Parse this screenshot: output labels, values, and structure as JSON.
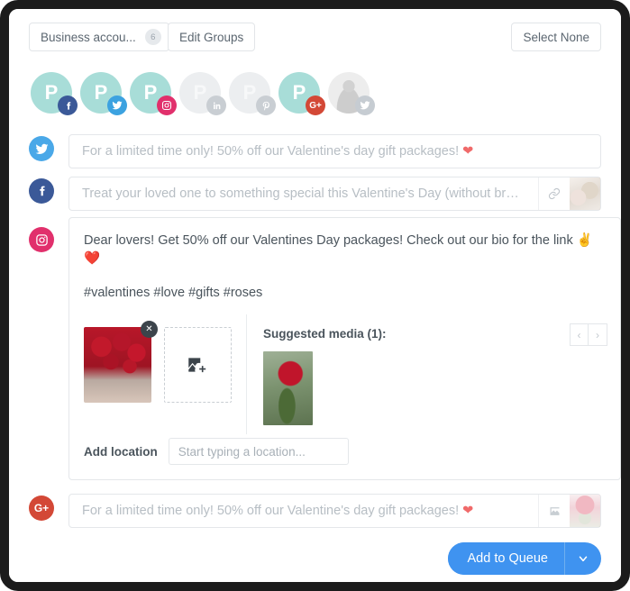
{
  "toolbar": {
    "group_select_label": "Business accou...",
    "group_select_count": "6",
    "edit_groups_label": "Edit Groups",
    "select_none_label": "Select None"
  },
  "accounts": [
    {
      "name": "profile-facebook",
      "letter": "P",
      "network": "facebook",
      "badge_label": "f",
      "active": true,
      "photo": false
    },
    {
      "name": "profile-twitter",
      "letter": "P",
      "network": "twitter",
      "badge_label": "t",
      "active": true,
      "photo": false
    },
    {
      "name": "profile-instagram",
      "letter": "P",
      "network": "instagram",
      "badge_label": "ig",
      "active": true,
      "photo": false
    },
    {
      "name": "profile-linkedin",
      "letter": "P",
      "network": "linkedin",
      "badge_label": "in",
      "active": false,
      "photo": false
    },
    {
      "name": "profile-pinterest",
      "letter": "P",
      "network": "pinterest",
      "badge_label": "p",
      "active": false,
      "photo": false
    },
    {
      "name": "profile-googleplus",
      "letter": "P",
      "network": "googleplus",
      "badge_label": "G+",
      "active": true,
      "photo": false
    },
    {
      "name": "profile-photo-twitter",
      "letter": "",
      "network": "twitter-muted",
      "badge_label": "t",
      "active": false,
      "photo": true
    }
  ],
  "composers": {
    "twitter": {
      "icon": "twitter-icon",
      "text": "For a limited time only! 50% off our Valentine's day gift packages! ",
      "emoji": "❤"
    },
    "facebook": {
      "icon": "facebook-icon",
      "text": "Treat your loved one to something special this Valentine's Day (without breakin...",
      "link_icon": "link-icon",
      "thumb_name": "facebook-attachment-thumbnail"
    },
    "instagram": {
      "icon": "instagram-icon",
      "text": "Dear lovers! Get 50% off our Valentines Day packages! Check out our bio for the link ✌️ ❤️",
      "hashtags": "#valentines #love #gifts #roses",
      "attached_media_name": "red-roses-bouquet",
      "remove_label": "✕",
      "add_media_label": "add-image",
      "suggested_title": "Suggested media (1):",
      "suggested_media_name": "red-rose-photo",
      "prev_label": "‹",
      "next_label": "›",
      "location_label": "Add location",
      "location_placeholder": "Start typing a location...",
      "location_value": ""
    },
    "googleplus": {
      "icon": "googleplus-icon",
      "text": "For a limited time only! 50% off our Valentine's day gift packages! ",
      "emoji": "❤",
      "image_icon": "image-icon",
      "thumb_name": "googleplus-attachment-thumbnail"
    }
  },
  "footer": {
    "add_to_queue_label": "Add to Queue",
    "dropdown_icon": "chevron-down-icon"
  },
  "colors": {
    "accent_blue": "#3f93f0",
    "facebook": "#3b5998",
    "twitter": "#4aa8e8",
    "instagram": "#e1306c",
    "googleplus": "#d34836",
    "avatar_teal": "#a8ddd8",
    "heart_red": "#f06a6a"
  }
}
